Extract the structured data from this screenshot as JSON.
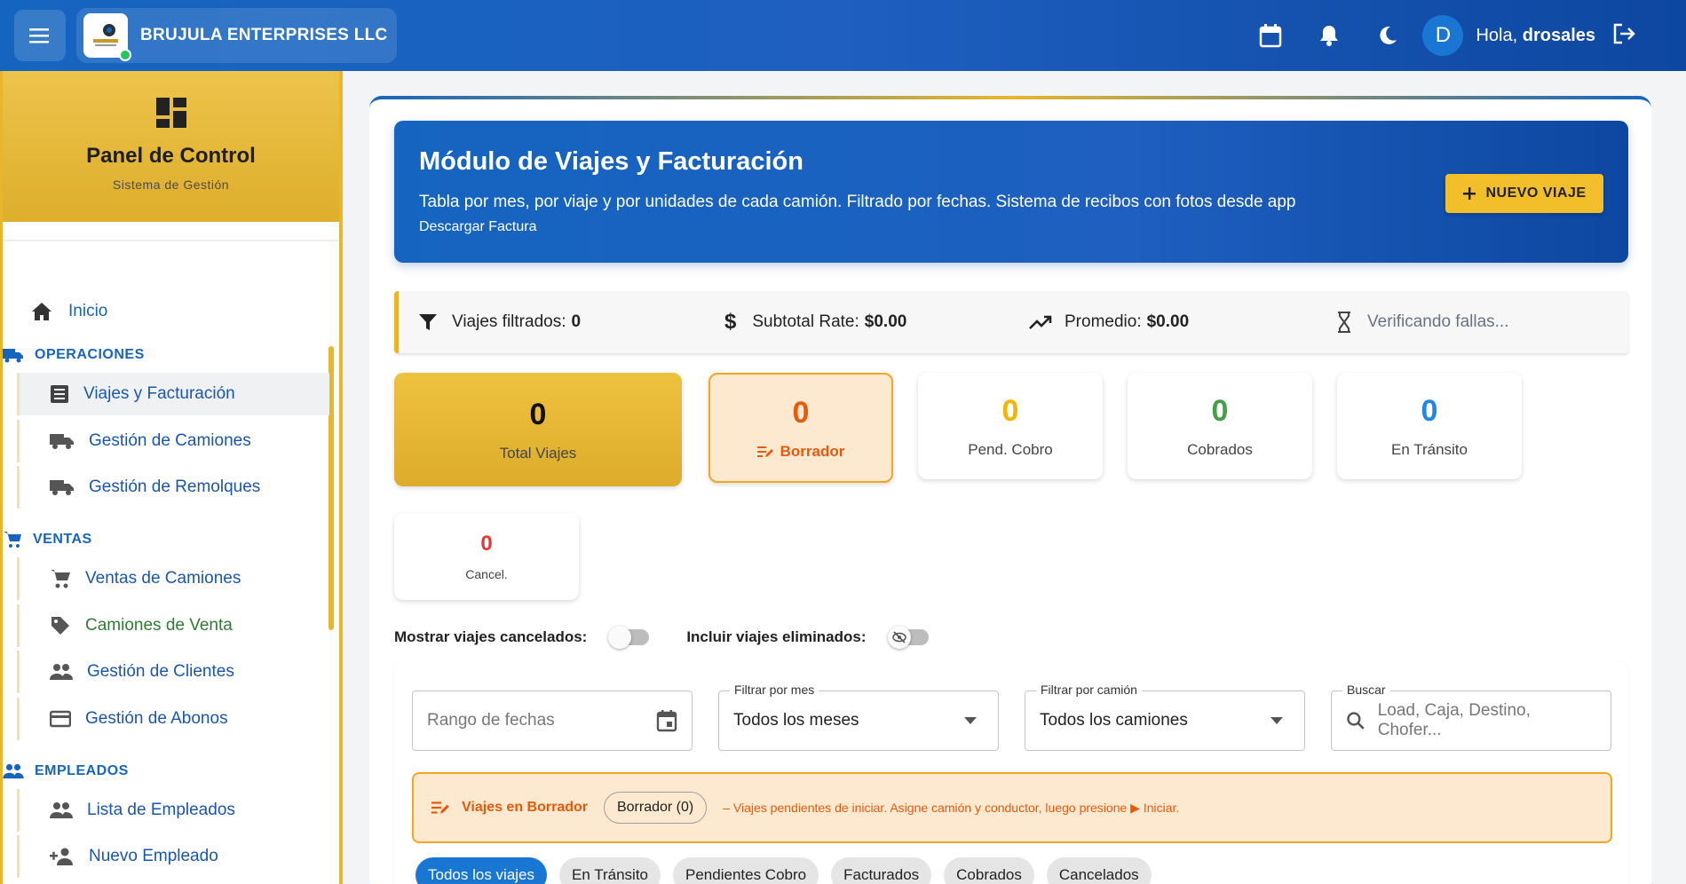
{
  "header": {
    "company": "BRUJULA ENTERPRISES LLC",
    "avatar_letter": "D",
    "greeting_prefix": "Hola,",
    "username": "drosales"
  },
  "sidebar": {
    "title": "Panel de Control",
    "subtitle": "Sistema de Gestión",
    "home": "Inicio",
    "sections": {
      "operaciones": "OPERACIONES",
      "ventas": "VENTAS",
      "empleados": "EMPLEADOS"
    },
    "items": {
      "viajes": "Viajes y Facturación",
      "camiones": "Gestión de Camiones",
      "remolques": "Gestión de Remolques",
      "ventas_camiones": "Ventas de Camiones",
      "camiones_venta": "Camiones de Venta",
      "clientes": "Gestión de Clientes",
      "abonos": "Gestión de Abonos",
      "lista_empleados": "Lista de Empleados",
      "nuevo_empleado": "Nuevo Empleado"
    }
  },
  "hero": {
    "title": "Módulo de Viajes y Facturación",
    "description": "Tabla por mes, por viaje y por unidades de cada camión. Filtrado por fechas. Sistema de recibos con fotos desde app",
    "link": "Descargar Factura",
    "new_button": "NUEVO VIAJE"
  },
  "stats": {
    "filtered_label": "Viajes filtrados:",
    "filtered_value": "0",
    "subtotal_label": "Subtotal Rate:",
    "subtotal_value": "$0.00",
    "avg_label": "Promedio:",
    "avg_value": "$0.00",
    "checking": "Verificando fallas..."
  },
  "cards": {
    "total": {
      "value": "0",
      "label": "Total Viajes"
    },
    "borrador": {
      "value": "0",
      "label": "Borrador"
    },
    "pend_cobro": {
      "value": "0",
      "label": "Pend. Cobro"
    },
    "cobrados": {
      "value": "0",
      "label": "Cobrados"
    },
    "transito": {
      "value": "0",
      "label": "En Tránsito"
    },
    "cancel": {
      "value": "0",
      "label": "Cancel."
    }
  },
  "colors": {
    "pend_cobro": "#f4b400",
    "cobrados": "#43a047",
    "transito": "#1e88e5",
    "cancel": "#e53935"
  },
  "toggles": {
    "cancelados": "Mostrar viajes cancelados:",
    "eliminados": "Incluir viajes eliminados:"
  },
  "filters": {
    "date_range_placeholder": "Rango de fechas",
    "month_label": "Filtrar por mes",
    "month_value": "Todos los meses",
    "truck_label": "Filtrar por camión",
    "truck_value": "Todos los camiones",
    "search_label": "Buscar",
    "search_placeholder": "Load, Caja, Destino, Chofer..."
  },
  "draft_banner": {
    "title": "Viajes en Borrador",
    "chip": "Borrador (0)",
    "note": "– Viajes pendientes de iniciar. Asigne camión y conductor, luego presione ▶ Iniciar."
  },
  "tabs": [
    "Todos los viajes",
    "En Tránsito",
    "Pendientes Cobro",
    "Facturados",
    "Cobrados",
    "Cancelados"
  ]
}
